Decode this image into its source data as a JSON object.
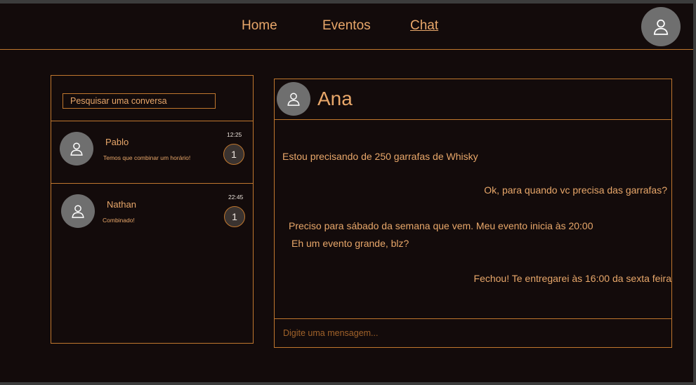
{
  "nav": {
    "links": [
      {
        "label": "Home",
        "active": false
      },
      {
        "label": "Eventos",
        "active": false
      },
      {
        "label": "Chat",
        "active": true
      }
    ],
    "profile_icon": "user-icon"
  },
  "conversations": {
    "search_placeholder": "Pesquisar uma conversa",
    "items": [
      {
        "name": "Pablo",
        "preview": "Temos que combinar um horário!",
        "time": "12:25",
        "unread": "1",
        "icon": "user-icon"
      },
      {
        "name": "Nathan",
        "preview": "Combinado!",
        "time": "22:45",
        "unread": "1",
        "icon": "user-icon"
      }
    ]
  },
  "chat": {
    "contact_name": "Ana",
    "contact_icon": "user-icon",
    "messages": [
      {
        "text": "Estou precisando de 250 garrafas de Whisky",
        "side": "left"
      },
      {
        "text": "Ok, para quando vc precisa das garrafas?",
        "side": "right"
      },
      {
        "text": "Preciso para sábado da semana que vem. Meu evento inicia às 20:00",
        "side": "left"
      },
      {
        "text": "Eh um evento grande, blz?",
        "side": "left"
      },
      {
        "text": "Fechou! Te entregarei às 16:00 da sexta feira",
        "side": "right"
      }
    ],
    "input_placeholder": "Digite uma mensagem..."
  },
  "colors": {
    "background": "#130b0b",
    "accent": "#e8a76a",
    "border": "#c0772e",
    "avatar": "#6f6f6f"
  }
}
